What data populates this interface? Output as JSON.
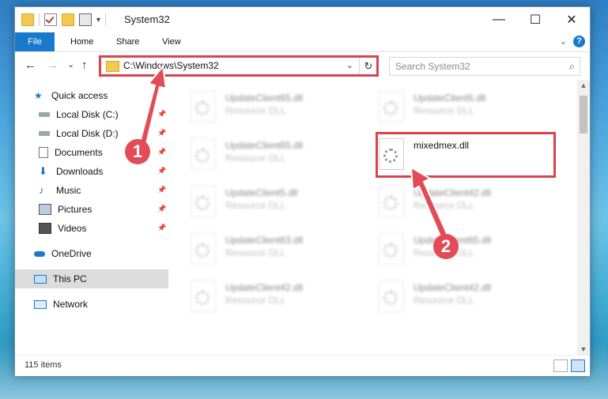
{
  "window": {
    "title": "System32"
  },
  "ribbon": {
    "tabs": [
      "File",
      "Home",
      "Share",
      "View"
    ],
    "help_label": "?"
  },
  "winbtns": {
    "minimize": "—",
    "maximize": "☐",
    "close": "✕"
  },
  "nav": {
    "back": "←",
    "forward": "→",
    "recent": "⌄",
    "up": "↑"
  },
  "address": {
    "path": "C:\\Windows\\System32",
    "dropdown": "⌄",
    "refresh": "↻"
  },
  "search": {
    "placeholder": "Search System32",
    "icon": "⌕"
  },
  "sidebar": {
    "items": [
      {
        "label": "Quick access",
        "icon": "star-icon",
        "pinned": false
      },
      {
        "label": "Local Disk (C:)",
        "icon": "drive-icon",
        "pinned": true
      },
      {
        "label": "Local Disk (D:)",
        "icon": "drive-icon",
        "pinned": true
      },
      {
        "label": "Documents",
        "icon": "document-icon",
        "pinned": true
      },
      {
        "label": "Downloads",
        "icon": "download-icon",
        "pinned": true
      },
      {
        "label": "Music",
        "icon": "music-icon",
        "pinned": true
      },
      {
        "label": "Pictures",
        "icon": "pictures-icon",
        "pinned": true
      },
      {
        "label": "Videos",
        "icon": "videos-icon",
        "pinned": true
      },
      {
        "label": "OneDrive",
        "icon": "cloud-icon",
        "pinned": false
      },
      {
        "label": "This PC",
        "icon": "computer-icon",
        "pinned": false,
        "selected": true
      },
      {
        "label": "Network",
        "icon": "network-icon",
        "pinned": false
      }
    ]
  },
  "files": [
    {
      "name": "UpdateClient65.dll",
      "type": "Resource DLL",
      "blurred": true
    },
    {
      "name": "UpdateClient5.dll",
      "type": "Resource DLL",
      "blurred": true
    },
    {
      "name": "UpdateClient65.dll",
      "type": "Resource DLL",
      "blurred": true
    },
    {
      "name": "mixedmex.dll",
      "type": "",
      "blurred": false,
      "highlighted": true
    },
    {
      "name": "UpdateClient5.dll",
      "type": "Resource DLL",
      "blurred": true
    },
    {
      "name": "UpdateClient42.dll",
      "type": "Resource DLL",
      "blurred": true
    },
    {
      "name": "UpdateClient63.dll",
      "type": "Resource DLL",
      "blurred": true
    },
    {
      "name": "UpdateClient65.dll",
      "type": "Resource DLL",
      "blurred": true
    },
    {
      "name": "UpdateClient42.dll",
      "type": "Resource DLL",
      "blurred": true
    },
    {
      "name": "UpdateClient42.dll",
      "type": "Resource DLL",
      "blurred": true
    }
  ],
  "status": {
    "item_count": "115 items"
  },
  "callouts": [
    "1",
    "2"
  ],
  "colors": {
    "accent": "#1979ca",
    "highlight_red": "#d9434d",
    "selected_bg": "#dcdcdc"
  }
}
